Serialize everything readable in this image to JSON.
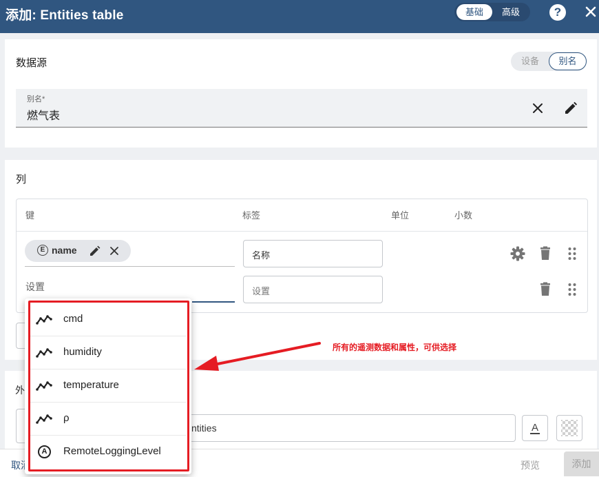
{
  "header": {
    "title": "添加: Entities table",
    "mode_basic": "基础",
    "mode_advanced": "高级",
    "help": "?"
  },
  "datasource": {
    "title": "数据源",
    "type_device": "设备",
    "type_alias": "别名",
    "alias_label": "别名*",
    "alias_value": "燃气表"
  },
  "columns": {
    "title": "列",
    "headers": {
      "key": "键",
      "label": "标签",
      "unit": "单位",
      "decimals": "小数"
    },
    "row1": {
      "key_type_badge": "E",
      "key": "name",
      "label_value": "名称"
    },
    "row2": {
      "key_input": "设置",
      "label_placeholder": "设置"
    }
  },
  "key_dropdown": {
    "items": [
      {
        "label": "cmd",
        "icon": "timeseries-icon"
      },
      {
        "label": "humidity",
        "icon": "timeseries-icon"
      },
      {
        "label": "temperature",
        "icon": "timeseries-icon"
      },
      {
        "label": "ρ",
        "icon": "timeseries-icon"
      },
      {
        "label": "RemoteLoggingLevel",
        "icon": "attribute-icon"
      }
    ],
    "attribute_badge": "A"
  },
  "annotation": {
    "text": "所有的遥测数据和属性，可供选择",
    "color": "#e51c23"
  },
  "appearance": {
    "title_partial": "外",
    "title_value_partial": "ntities"
  },
  "footer": {
    "cancel_partial": "取消",
    "preview": "预览",
    "add": "添加"
  },
  "colors": {
    "primary": "#305680",
    "accent_red": "#e51c23"
  }
}
